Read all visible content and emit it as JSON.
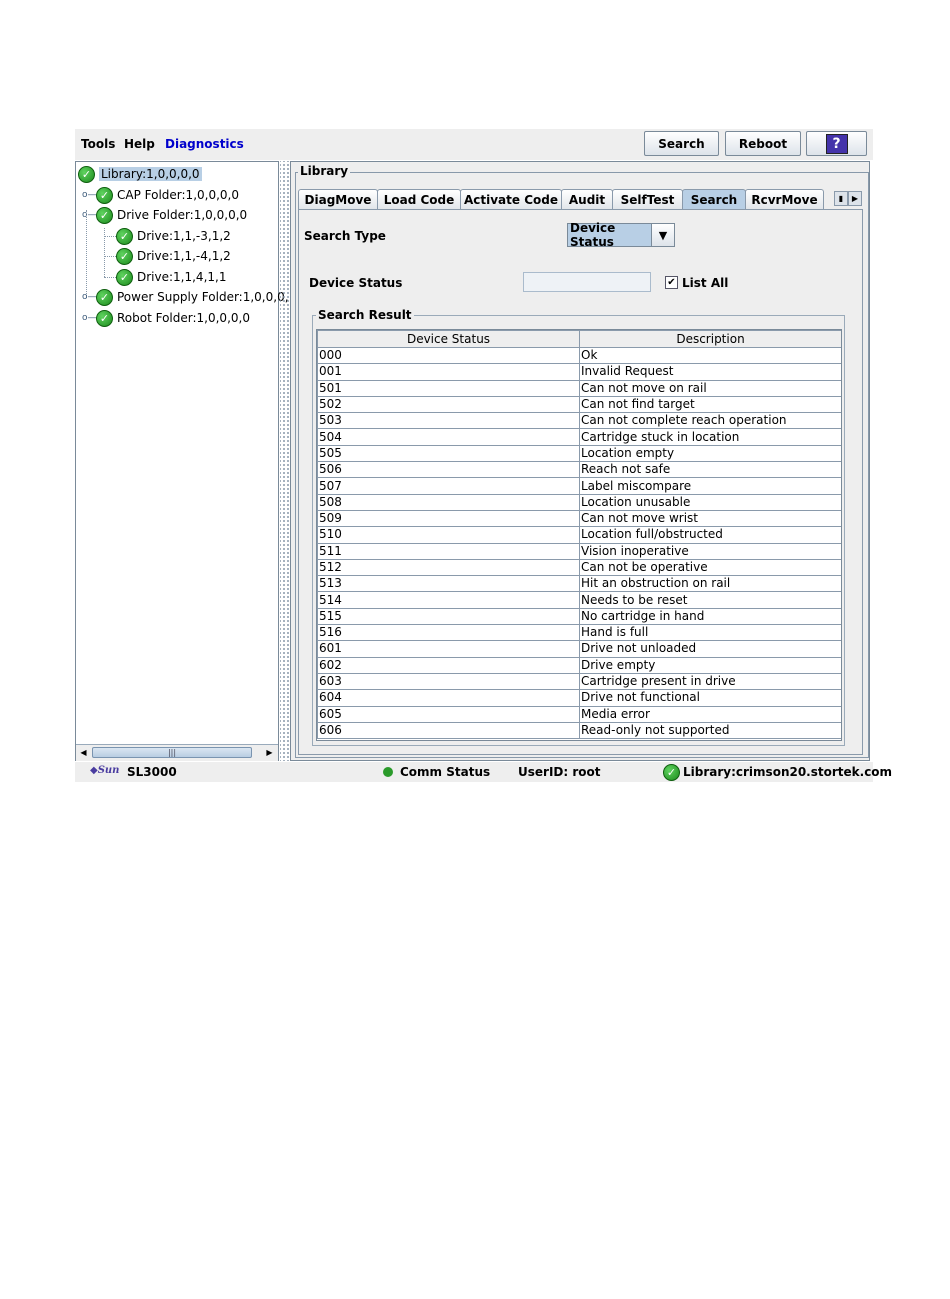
{
  "menu": {
    "tools": "Tools",
    "help": "Help",
    "diagnostics": "Diagnostics"
  },
  "toolbar": {
    "search": "Search",
    "reboot": "Reboot",
    "help_icon": "?"
  },
  "tree": {
    "library": "Library:1,0,0,0,0",
    "cap_folder": "CAP Folder:1,0,0,0,0",
    "drive_folder": "Drive Folder:1,0,0,0,0",
    "drives": [
      "Drive:1,1,-3,1,2",
      "Drive:1,1,-4,1,2",
      "Drive:1,1,4,1,1"
    ],
    "power_supply_folder": "Power Supply Folder:1,0,0,0,",
    "robot_folder": "Robot Folder:1,0,0,0,0"
  },
  "panel": {
    "title": "Library",
    "tabs": [
      "DiagMove",
      "Load Code",
      "Activate Code",
      "Audit",
      "SelfTest",
      "Search",
      "RcvrMove"
    ],
    "active_tab": "Search",
    "search_type_label": "Search Type",
    "search_type_value": "Device Status",
    "device_status_label": "Device Status",
    "device_status_value": "",
    "list_all_label": "List All",
    "list_all_checked": true,
    "result_title": "Search Result",
    "columns": [
      "Device Status",
      "Description"
    ],
    "rows": [
      [
        "000",
        "Ok"
      ],
      [
        "001",
        "Invalid Request"
      ],
      [
        "501",
        "Can not move on rail"
      ],
      [
        "502",
        "Can not find target"
      ],
      [
        "503",
        "Can not complete reach operation"
      ],
      [
        "504",
        "Cartridge stuck in location"
      ],
      [
        "505",
        "Location empty"
      ],
      [
        "506",
        "Reach not safe"
      ],
      [
        "507",
        "Label miscompare"
      ],
      [
        "508",
        "Location unusable"
      ],
      [
        "509",
        "Can not move wrist"
      ],
      [
        "510",
        "Location full/obstructed"
      ],
      [
        "511",
        "Vision inoperative"
      ],
      [
        "512",
        "Can not be operative"
      ],
      [
        "513",
        "Hit an obstruction on rail"
      ],
      [
        "514",
        "Needs to be reset"
      ],
      [
        "515",
        "No cartridge in hand"
      ],
      [
        "516",
        "Hand is full"
      ],
      [
        "601",
        "Drive not unloaded"
      ],
      [
        "602",
        "Drive empty"
      ],
      [
        "603",
        "Cartridge present in drive"
      ],
      [
        "604",
        "Drive not functional"
      ],
      [
        "605",
        "Media error"
      ],
      [
        "606",
        "Read-only not supported"
      ]
    ]
  },
  "statusbar": {
    "logo": "Sun",
    "product": "SL3000",
    "comm_status": "Comm Status",
    "user_id": "UserID: root",
    "library": "Library:crimson20.stortek.com"
  },
  "colors": {
    "selection": "#b8cfe5",
    "diagnostics_menu": "#0000cc",
    "ok_green": "#1c8a1c",
    "help_button": "#4433aa"
  }
}
